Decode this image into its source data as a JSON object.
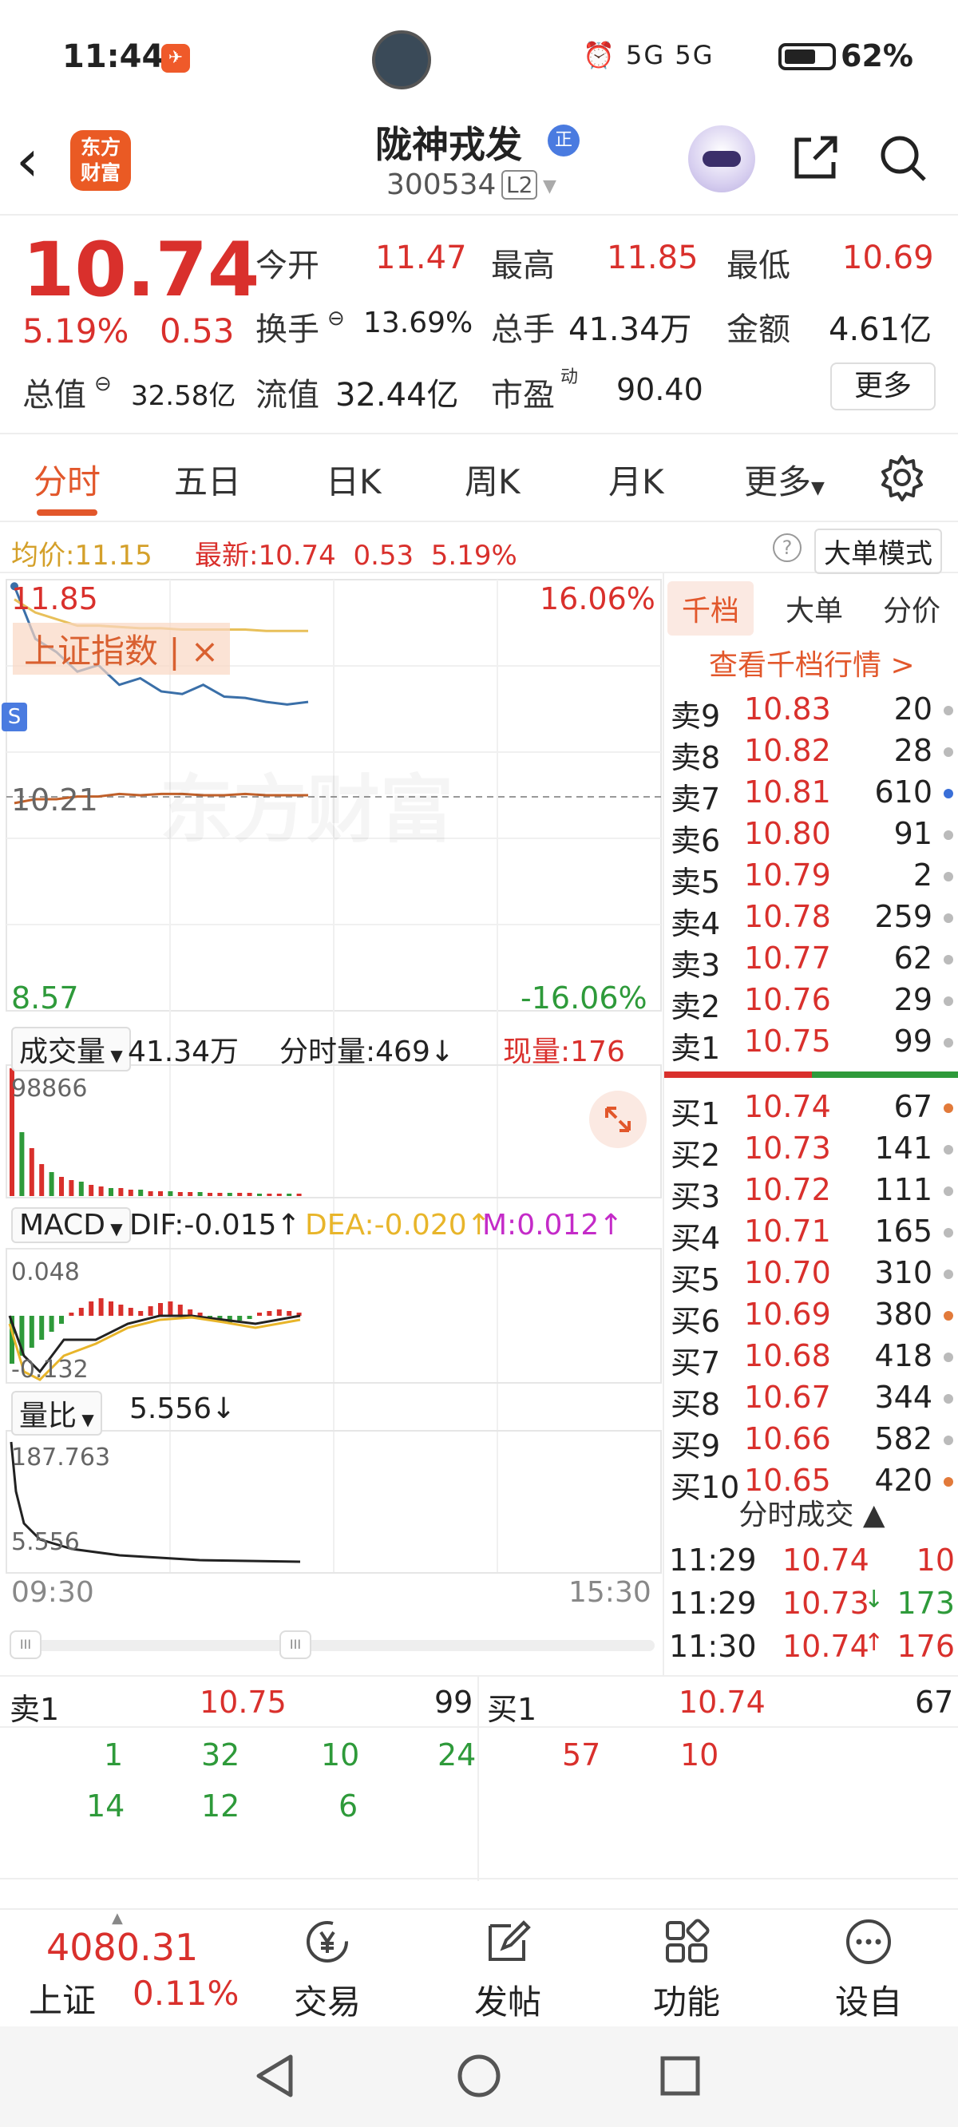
{
  "status_bar": {
    "time": "11:44",
    "battery": "62%",
    "network_icons": "⏰ 5G 5G"
  },
  "header": {
    "logo_lines": [
      "东方",
      "财富"
    ],
    "title": "陇神戎发",
    "badge": "正",
    "code": "300534",
    "level": "L2"
  },
  "quote": {
    "price": "10.74",
    "change_pct": "5.19%",
    "change": "0.53",
    "fields": [
      {
        "label": "今开",
        "value": "11.47"
      },
      {
        "label": "最高",
        "value": "11.85"
      },
      {
        "label": "最低",
        "value": "10.69"
      },
      {
        "label": "换手",
        "value": "13.69%"
      },
      {
        "label": "总手",
        "value": "41.34万"
      },
      {
        "label": "金额",
        "value": "4.61亿"
      },
      {
        "label": "总值",
        "value": "32.58亿"
      },
      {
        "label": "流值",
        "value": "32.44亿"
      },
      {
        "label": "市盈",
        "value": "90.40",
        "sup": "动"
      }
    ],
    "more_label": "更多"
  },
  "tabs": [
    "分时",
    "五日",
    "日K",
    "周K",
    "月K",
    "更多"
  ],
  "infobar": {
    "avg_label": "均价:",
    "avg_value": "11.15",
    "last_label": "最新:",
    "last_value": "10.74",
    "last_change": "0.53",
    "last_pct": "5.19%",
    "help": "?",
    "mode_label": "大单模式"
  },
  "chart_labels": {
    "high": "11.85",
    "high_pct": "16.06%",
    "mid": "10.21",
    "low": "8.57",
    "low_pct": "-16.06%",
    "index_overlay": "上证指数 | ×",
    "watermark": "东方财富",
    "s_badge": "S",
    "volume_selector": "成交量",
    "volume_total": "41.34万",
    "minute_volume": "分时量:469↓",
    "current_volume": "现量:176",
    "volume_max": "98866",
    "macd_selector": "MACD",
    "dif": "DIF:-0.015↑",
    "dea": "DEA:-0.020↑",
    "m": "M:0.012↑",
    "macd_top": "0.048",
    "macd_bottom": "-0.132",
    "ratio_selector": "量比",
    "ratio_value": "5.556↓",
    "ratio_max": "187.763",
    "ratio_min": "5.556",
    "time_start": "09:30",
    "time_end": "15:30",
    "scroll_grip": "III"
  },
  "chart_data": {
    "type": "line",
    "title": "",
    "x_range": [
      "09:30",
      "15:30"
    ],
    "ylim": [
      8.57,
      11.85
    ],
    "reference_price": 10.21,
    "series": [
      {
        "name": "上证指数",
        "values": [
          11.8,
          11.4,
          11.3,
          11.15,
          11.2,
          11.05,
          11.1,
          11.0,
          10.98,
          11.05,
          10.96,
          10.95,
          10.92,
          10.9,
          10.92
        ]
      },
      {
        "values": [
          10.15,
          10.18,
          10.18,
          10.2,
          10.2,
          10.22,
          10.21,
          10.22,
          10.22,
          10.21,
          10.21,
          10.22,
          10.21,
          10.21,
          10.21
        ]
      },
      {
        "values": [
          11.7,
          11.6,
          11.55,
          11.5,
          11.5,
          11.49,
          11.48,
          11.48,
          11.47,
          11.47,
          11.47,
          11.47,
          11.46,
          11.46,
          11.46
        ]
      }
    ]
  },
  "order_book": {
    "tabs": [
      "千档",
      "大单",
      "分价"
    ],
    "link": "查看千档行情 >",
    "asks": [
      {
        "label": "卖9",
        "price": "10.83",
        "vol": "20",
        "dot": "#bbb"
      },
      {
        "label": "卖8",
        "price": "10.82",
        "vol": "28",
        "dot": "#bbb"
      },
      {
        "label": "卖7",
        "price": "10.81",
        "vol": "610",
        "dot": "#3a6fd8"
      },
      {
        "label": "卖6",
        "price": "10.80",
        "vol": "91",
        "dot": "#bbb"
      },
      {
        "label": "卖5",
        "price": "10.79",
        "vol": "2",
        "dot": "#bbb"
      },
      {
        "label": "卖4",
        "price": "10.78",
        "vol": "259",
        "dot": "#bbb"
      },
      {
        "label": "卖3",
        "price": "10.77",
        "vol": "62",
        "dot": "#bbb"
      },
      {
        "label": "卖2",
        "price": "10.76",
        "vol": "29",
        "dot": "#bbb"
      },
      {
        "label": "卖1",
        "price": "10.75",
        "vol": "99",
        "dot": "#bbb"
      }
    ],
    "bids": [
      {
        "label": "买1",
        "price": "10.74",
        "vol": "67",
        "dot": "#e27a3a"
      },
      {
        "label": "买2",
        "price": "10.73",
        "vol": "141",
        "dot": "#bbb"
      },
      {
        "label": "买3",
        "price": "10.72",
        "vol": "111",
        "dot": "#bbb"
      },
      {
        "label": "买4",
        "price": "10.71",
        "vol": "165",
        "dot": "#bbb"
      },
      {
        "label": "买5",
        "price": "10.70",
        "vol": "310",
        "dot": "#bbb"
      },
      {
        "label": "买6",
        "price": "10.69",
        "vol": "380",
        "dot": "#e27a3a"
      },
      {
        "label": "买7",
        "price": "10.68",
        "vol": "418",
        "dot": "#bbb"
      },
      {
        "label": "买8",
        "price": "10.67",
        "vol": "344",
        "dot": "#bbb"
      },
      {
        "label": "买9",
        "price": "10.66",
        "vol": "582",
        "dot": "#bbb"
      },
      {
        "label": "买10",
        "price": "10.65",
        "vol": "420",
        "dot": "#e27a3a"
      }
    ],
    "trades_header": "分时成交 ▲",
    "trades": [
      {
        "time": "11:29",
        "price": "10.74",
        "arrow": "",
        "vol": "10",
        "vol_color": "#d9302c"
      },
      {
        "time": "11:29",
        "price": "10.73",
        "arrow": "↓",
        "vol": "173",
        "vol_color": "#2e9a3a"
      },
      {
        "time": "11:30",
        "price": "10.74",
        "arrow": "↑",
        "vol": "176",
        "vol_color": "#d9302c"
      }
    ]
  },
  "bottom_book": {
    "sell_label": "卖1",
    "sell_price": "10.75",
    "sell_vol": "99",
    "buy_label": "买1",
    "buy_price": "10.74",
    "buy_vol": "67",
    "sell_queue": [
      "1",
      "32",
      "10",
      "24",
      "14",
      "12",
      "6"
    ],
    "buy_queue": [
      "57",
      "10"
    ]
  },
  "dock": {
    "index_value": "4080.31",
    "index_name": "上证",
    "index_pct": "0.11%",
    "items": [
      {
        "label": "交易",
        "icon": "yen-exchange-icon"
      },
      {
        "label": "发帖",
        "icon": "edit-icon"
      },
      {
        "label": "功能",
        "icon": "apps-icon"
      },
      {
        "label": "设自选",
        "icon": "more-icon"
      }
    ]
  },
  "colors": {
    "up": "#d9302c",
    "down": "#2e9a3a",
    "accent": "#e2572b",
    "avg": "#d4a02a",
    "index_line": "#3a6fa8"
  }
}
